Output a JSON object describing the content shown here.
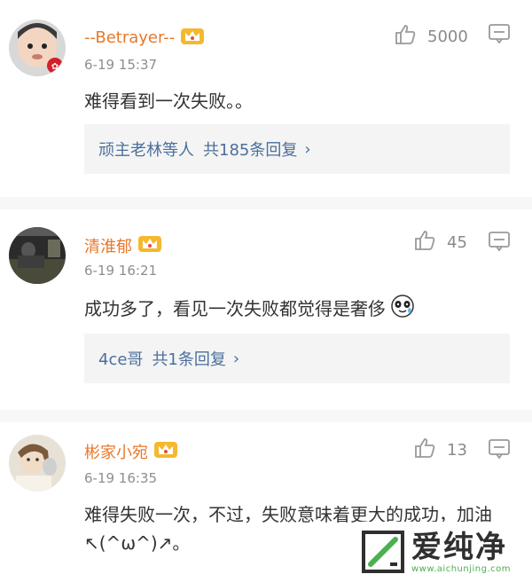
{
  "comments": [
    {
      "username": "--Betrayer--",
      "time": "6-19 15:37",
      "text": "难得看到一次失败。。",
      "likes": "5000",
      "reply_users": "顽主老林等人",
      "reply_count": "共185条回复",
      "badge": "crown-badge",
      "avatar": "baby-avatar"
    },
    {
      "username": "清淮郁",
      "time": "6-19 16:21",
      "text": "成功多了，看见一次失败都觉得是奢侈",
      "emoji": "panda-emoji",
      "likes": "45",
      "reply_users": "4ce哥",
      "reply_count": "共1条回复",
      "badge": "crown-badge",
      "avatar": "dark-photo-avatar"
    },
    {
      "username": "彬家小宛",
      "time": "6-19 16:35",
      "text": "难得失败一次，不过，失败意味着更大的成功，加油↖(^ω^)↗。",
      "likes": "13",
      "badge": "crown-badge",
      "avatar": "girl-avatar"
    }
  ],
  "watermark": {
    "title": "爱纯净",
    "url": "www.aichunjing.com"
  },
  "colors": {
    "username": "#e8782a",
    "link": "#4b6f9c",
    "meta": "#8e8e8e",
    "text": "#333333"
  }
}
